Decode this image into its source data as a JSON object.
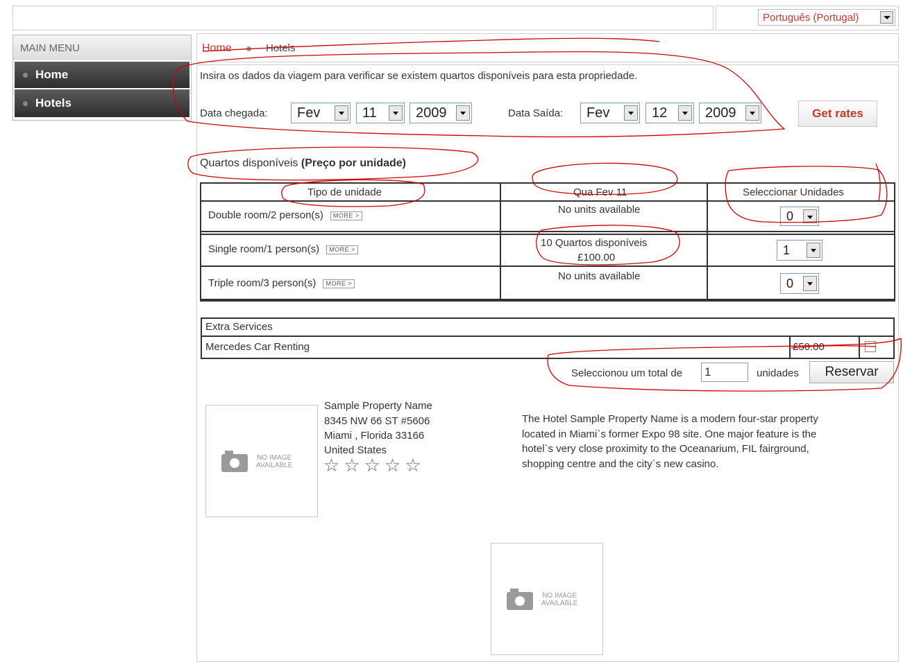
{
  "language": {
    "selected": "Português (Portugal)"
  },
  "sidebar": {
    "title": "MAIN MENU",
    "items": [
      {
        "label": "Home"
      },
      {
        "label": "Hotels"
      }
    ]
  },
  "breadcrumb": {
    "home": "Home",
    "current": "Hotels"
  },
  "booking": {
    "intro": "Insira os dados da viagem para verificar se existem quartos disponíveis para esta propriedade.",
    "arrival_label": "Data chegada:",
    "arrival": {
      "month": "Fev",
      "day": "11",
      "year": "2009"
    },
    "departure_label": "Data Saída:",
    "departure": {
      "month": "Fev",
      "day": "12",
      "year": "2009"
    },
    "get_rates": "Get rates"
  },
  "rooms": {
    "heading_plain": "Quartos disponíveis",
    "heading_bold": "(Preço por unidade)",
    "columns": [
      "Tipo de unidade",
      "Qua Fev 11",
      "Seleccionar Unidades"
    ],
    "more_label": "MORE >",
    "rows": [
      {
        "name": "Double room/2 person(s)",
        "availability": "No units available",
        "price": "",
        "selected": "0"
      },
      {
        "name": "Single room/1 person(s)",
        "availability": "10   Quartos disponíveis",
        "price": "£100.00",
        "selected": "1"
      },
      {
        "name": "Triple room/3 person(s)",
        "availability": "No units available",
        "price": "",
        "selected": "0"
      }
    ]
  },
  "extras": {
    "title": "Extra Services",
    "items": [
      {
        "name": "Mercedes Car Renting",
        "price": "£50.00",
        "checked": false
      }
    ]
  },
  "summary": {
    "prefix": "Seleccionou um total de",
    "count": "1",
    "suffix": "unidades",
    "reserve": "Reservar"
  },
  "property": {
    "name": "Sample Property Name",
    "address1": "8345 NW 66 ST #5606",
    "address2": "Miami ,  Florida   33166",
    "country": "United States",
    "stars": 5,
    "description": [
      "The Hotel Sample Property Name is a modern four-star property",
      "located in Miami`s former Expo 98 site. One major feature is the",
      "hotel`s very close proximity to the Oceanarium, FIL fairground,",
      "shopping centre and the city`s new casino."
    ],
    "no_image_line1": "NO IMAGE",
    "no_image_line2": "AVAILABLE"
  },
  "colors": {
    "accent": "#c0392b",
    "annotation": "#d40000",
    "sidebar_dark": "#3a3a3a"
  }
}
